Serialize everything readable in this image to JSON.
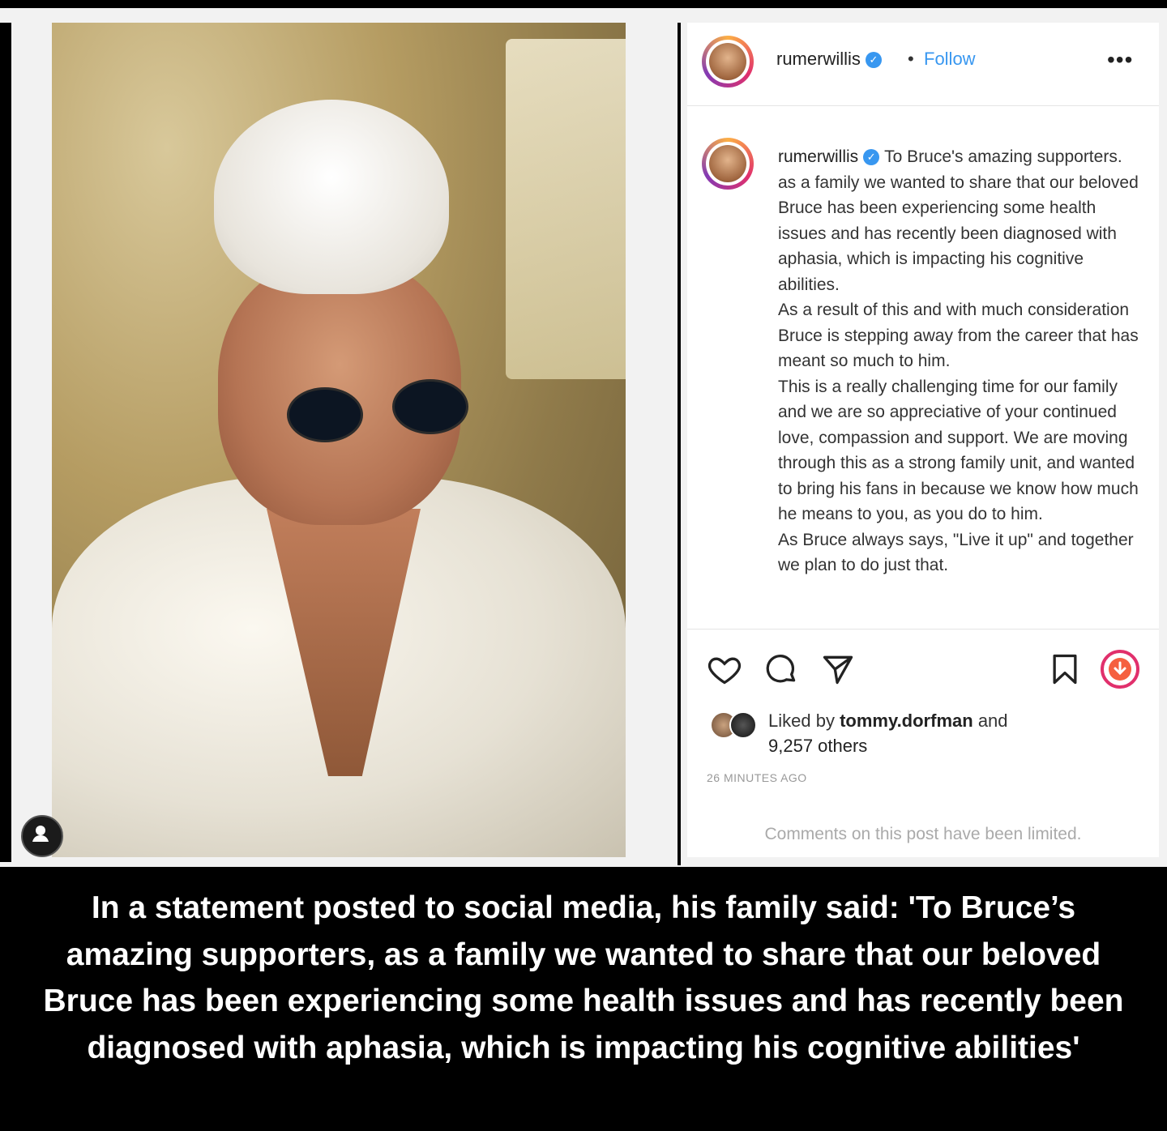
{
  "post": {
    "username": "rumerwillis",
    "separator": "•",
    "follow_label": "Follow",
    "more_label": "•••",
    "caption": "To Bruce's amazing supporters. as a family we wanted to share that our beloved Bruce has been experiencing some health issues and has recently been diagnosed with aphasia, which is impacting his cognitive abilities.\nAs a result of this and with much consideration Bruce is stepping away from the career that has meant so much to him.\nThis is a really challenging time for our family and we are so appreciative of your continued love, compassion and support. We are moving through this as a strong family unit, and wanted to bring his fans in because we know how much he means to you, as you do to him.\nAs Bruce always says, \"Live it up\" and together we plan to do just that.",
    "likes_prefix": "Liked by",
    "liked_by_user": "tommy.dorfman",
    "likes_and": "and",
    "likes_others": "9,257 others",
    "timestamp": "26 MINUTES AGO",
    "comments_limited": "Comments on this post have been limited."
  },
  "icons": [
    "heart-icon",
    "comment-icon",
    "share-icon",
    "bookmark-icon",
    "download-icon",
    "verified-icon",
    "profile-icon"
  ],
  "colors": {
    "link": "#3897f0",
    "verified": "#3897f0",
    "download_ring": "#e1306c"
  },
  "article_caption": "In a statement posted to social media, his family said: 'To Bruce’s amazing supporters, as a family we wanted to share that our beloved Bruce has been experiencing some health issues and has recently been diagnosed with aphasia, which is impacting his cognitive abilities'"
}
